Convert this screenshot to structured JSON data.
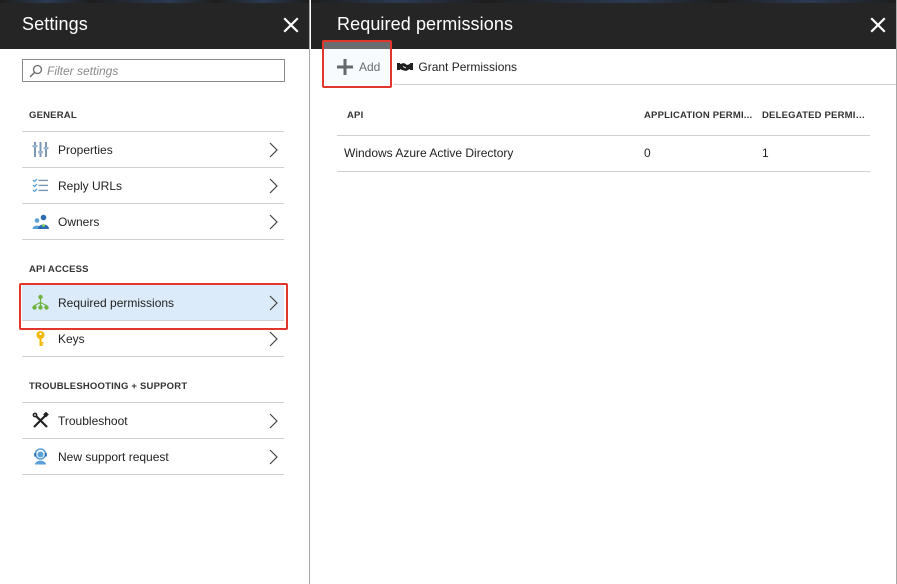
{
  "settings_blade": {
    "title": "Settings",
    "filter_placeholder": "Filter settings",
    "sections": [
      {
        "label": "GENERAL",
        "items": [
          {
            "label": "Properties",
            "icon": "properties-sliders-icon"
          },
          {
            "label": "Reply URLs",
            "icon": "reply-urls-list-icon"
          },
          {
            "label": "Owners",
            "icon": "owners-people-icon"
          }
        ]
      },
      {
        "label": "API ACCESS",
        "items": [
          {
            "label": "Required permissions",
            "icon": "permissions-network-icon",
            "selected": true
          },
          {
            "label": "Keys",
            "icon": "key-icon"
          }
        ]
      },
      {
        "label": "TROUBLESHOOTING + SUPPORT",
        "items": [
          {
            "label": "Troubleshoot",
            "icon": "wrench-tools-icon"
          },
          {
            "label": "New support request",
            "icon": "support-person-icon"
          }
        ]
      }
    ]
  },
  "permissions_blade": {
    "title": "Required permissions",
    "toolbar": {
      "add_label": "Add",
      "grant_label": "Grant Permissions"
    },
    "table": {
      "columns": [
        "API",
        "APPLICATION PERMI...",
        "DELEGATED PERMIS..."
      ],
      "rows": [
        {
          "api": "Windows Azure Active Directory",
          "application": "0",
          "delegated": "1"
        }
      ]
    }
  },
  "colors": {
    "header_bg": "#252526",
    "selected_bg": "#dcebf9",
    "highlight_outline": "#e2352b",
    "divider": "#d0d0d0"
  }
}
